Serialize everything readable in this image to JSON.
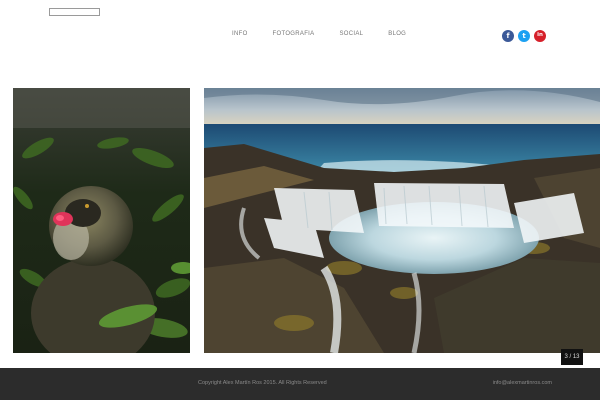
{
  "header": {
    "nav": [
      {
        "label": "INFO"
      },
      {
        "label": "FOTOGRAFIA"
      },
      {
        "label": "SOCIAL"
      },
      {
        "label": "BLOG"
      }
    ],
    "social": [
      {
        "icon": "facebook-icon",
        "glyph": "f",
        "color": "#3b5998"
      },
      {
        "icon": "twitter-icon",
        "glyph": "t",
        "color": "#1da1f2"
      },
      {
        "icon": "linkedin-icon",
        "glyph": "in",
        "color": "#d6202a"
      }
    ]
  },
  "gallery": {
    "counter": "3 / 13"
  },
  "footer": {
    "copyright": "Copyright Alex Martín Ros 2015. All Rights Reserved",
    "email": "info@alexmartinros.com"
  }
}
